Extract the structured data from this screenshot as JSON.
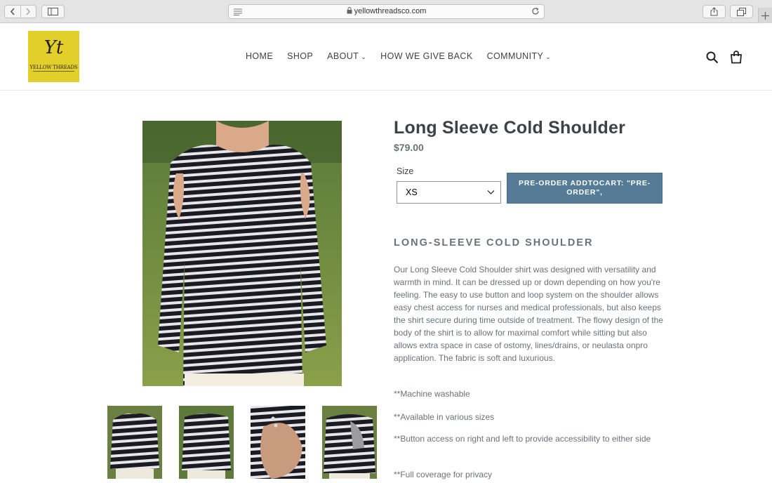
{
  "browser": {
    "url": "yellowthreadsco.com",
    "icons": [
      "back-icon",
      "forward-icon",
      "sidebar-icon",
      "reader-icon",
      "lock-icon",
      "reload-icon",
      "share-icon",
      "tabs-icon",
      "new-tab-icon"
    ]
  },
  "header": {
    "logo_monogram": "Yt",
    "logo_text": "YELLOW THREADS",
    "nav": [
      {
        "label": "HOME",
        "dropdown": false
      },
      {
        "label": "SHOP",
        "dropdown": false
      },
      {
        "label": "ABOUT",
        "dropdown": true
      },
      {
        "label": "HOW WE GIVE BACK",
        "dropdown": false
      },
      {
        "label": "COMMUNITY",
        "dropdown": true
      }
    ],
    "icons": [
      "search-icon",
      "cart-icon"
    ]
  },
  "product": {
    "title": "Long Sleeve Cold Shoulder",
    "price": "$79.00",
    "size_label": "Size",
    "size_value": "XS",
    "preorder_label": "PRE-ORDER ADDTOCART: \"PRE-ORDER\",",
    "thumbnail_count": 4,
    "description_heading": "LONG-SLEEVE COLD SHOULDER",
    "description": "Our Long Sleeve Cold Shoulder shirt was designed with versatility and warmth in mind. It can be dressed up or down depending on how you're feeling. The easy to use button and loop system on the shoulder allows easy chest access for nurses and medical professionals, but also keeps the shirt secure during time outside of treatment. The flowy design of the body of the shirt is to allow for maximal comfort while sitting but also allows extra space in case of ostomy, lines/drains, or neulasta onpro application. The fabric is soft and luxurious.",
    "features": [
      "**Machine washable",
      "**Available in various sizes",
      "**Button access on right and left to provide accessibility to either side",
      "**Full coverage for privacy"
    ]
  },
  "colors": {
    "logo_bg": "#e3cf2a",
    "button_bg": "#557b97",
    "text_muted": "#69727b",
    "text_dark": "#3d4246"
  }
}
